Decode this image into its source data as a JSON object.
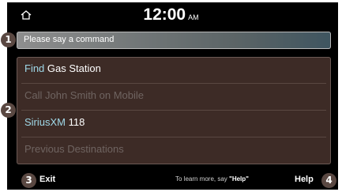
{
  "header": {
    "home_icon": "home-icon",
    "time": "12:00",
    "ampm": "AM"
  },
  "command_bar": {
    "text": "Please say a command"
  },
  "list": {
    "items": [
      {
        "highlight": "Find",
        "rest": " Gas Station",
        "enabled": true
      },
      {
        "highlight": "",
        "rest": "Call John Smith on Mobile",
        "enabled": false
      },
      {
        "highlight": "SiriusXM",
        "rest": " 118",
        "enabled": true
      },
      {
        "highlight": "",
        "rest": "Previous Destinations",
        "enabled": false
      }
    ]
  },
  "bottom": {
    "exit_label": "Exit",
    "hint_prefix": "To learn more, say ",
    "hint_keyword": "\"Help\"",
    "help_label": "Help"
  },
  "callouts": [
    "1",
    "2",
    "3",
    "4"
  ],
  "colors": {
    "highlight": "#9fd8e8",
    "list_bg": "#3d2b26",
    "marker_bg": "#5a4842"
  }
}
